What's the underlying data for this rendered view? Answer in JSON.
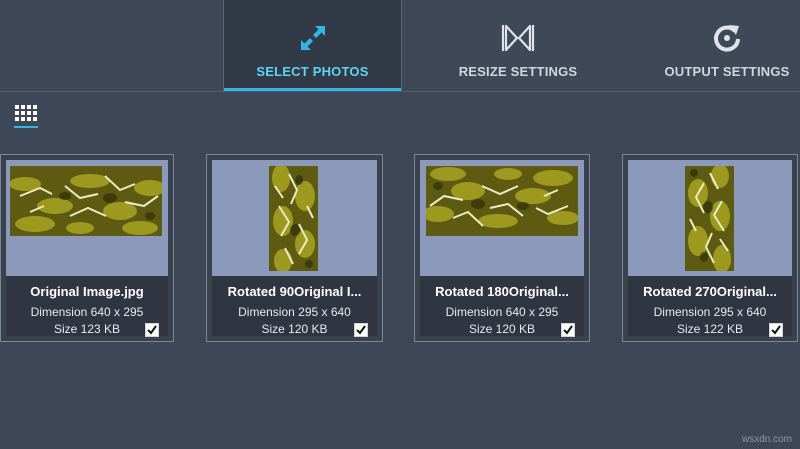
{
  "tabs": [
    {
      "label": "SELECT PHOTOS",
      "icon": "expand-arrows-icon",
      "active": true
    },
    {
      "label": "RESIZE SETTINGS",
      "icon": "resize-bowtie-icon",
      "active": false
    },
    {
      "label": "OUTPUT SETTINGS",
      "icon": "refresh-icon",
      "active": false
    }
  ],
  "view_toggle": {
    "icon": "grid-view-icon"
  },
  "photos": [
    {
      "name": "Original Image.jpg",
      "dimension": "Dimension 640 x 295",
      "size": "Size 123 KB",
      "checked": true
    },
    {
      "name": "Rotated 90Original I...",
      "dimension": "Dimension 295 x 640",
      "size": "Size 120 KB",
      "checked": true
    },
    {
      "name": "Rotated 180Original...",
      "dimension": "Dimension 640 x 295",
      "size": "Size 120 KB",
      "checked": true
    },
    {
      "name": "Rotated 270Original...",
      "dimension": "Dimension 295 x 640",
      "size": "Size 122 KB",
      "checked": true
    }
  ],
  "watermark": "wsxdn.com",
  "colors": {
    "accent": "#2fb8e6",
    "active_label": "#5fd3f3",
    "background": "#3e4757",
    "preview_bg": "#8b9abb"
  }
}
